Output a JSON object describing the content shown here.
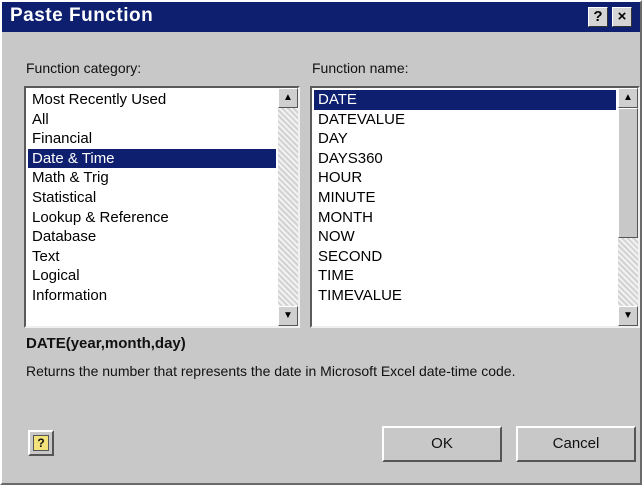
{
  "window": {
    "title": "Paste Function",
    "help_button": "?",
    "close_button": "×"
  },
  "category": {
    "label": "Function category:",
    "items": [
      "Most Recently Used",
      "All",
      "Financial",
      "Date & Time",
      "Math & Trig",
      "Statistical",
      "Lookup & Reference",
      "Database",
      "Text",
      "Logical",
      "Information"
    ],
    "selected_index": 3
  },
  "functions": {
    "label": "Function name:",
    "items": [
      "DATE",
      "DATEVALUE",
      "DAY",
      "DAYS360",
      "HOUR",
      "MINUTE",
      "MONTH",
      "NOW",
      "SECOND",
      "TIME",
      "TIMEVALUE"
    ],
    "selected_index": 0
  },
  "syntax": "DATE(year,month,day)",
  "description": "Returns the number that represents the date in Microsoft Excel date-time code.",
  "buttons": {
    "help": "?",
    "ok": "OK",
    "cancel": "Cancel"
  },
  "colors": {
    "title_bar": "#0d1f6e",
    "selection": "#0d1f6e",
    "dialog_face": "#c8c8c8"
  },
  "icons": {
    "scroll_up": "up-arrow",
    "scroll_down": "down-arrow",
    "help": "question-mark"
  }
}
